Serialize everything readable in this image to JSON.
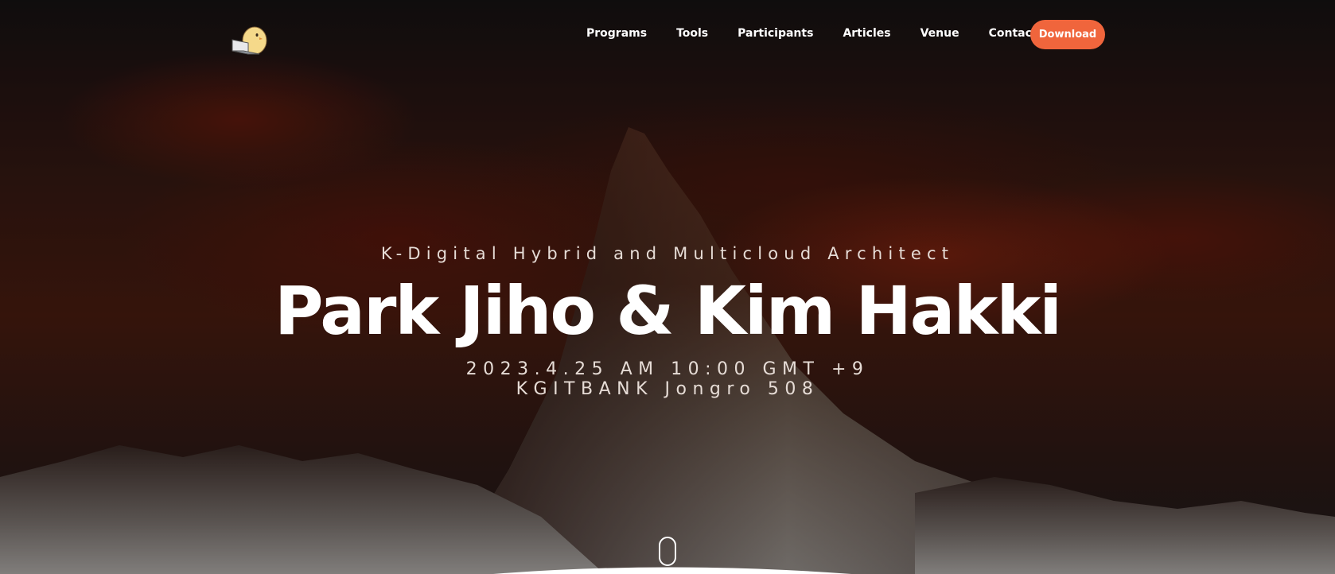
{
  "nav": {
    "logo_icon": "laptop-chick-icon",
    "links": [
      "Programs",
      "Tools",
      "Participants",
      "Articles",
      "Venue",
      "Contact"
    ],
    "download_label": "Download"
  },
  "hero": {
    "subtitle": "K-Digital Hybrid and Multicloud Architect",
    "title": "Park Jiho & Kim Hakki",
    "date": "2023.4.25 AM 10:00 GMT +9",
    "venue": "KGITBANK Jongro 508"
  },
  "scroll": {
    "icon": "mouse-scroll-icon"
  },
  "colors": {
    "accent": "#f0653c",
    "text": "#ffffff",
    "subtext": "#e6dcd6",
    "sky_dark": "#161313",
    "sky_red": "#4a1c10"
  }
}
